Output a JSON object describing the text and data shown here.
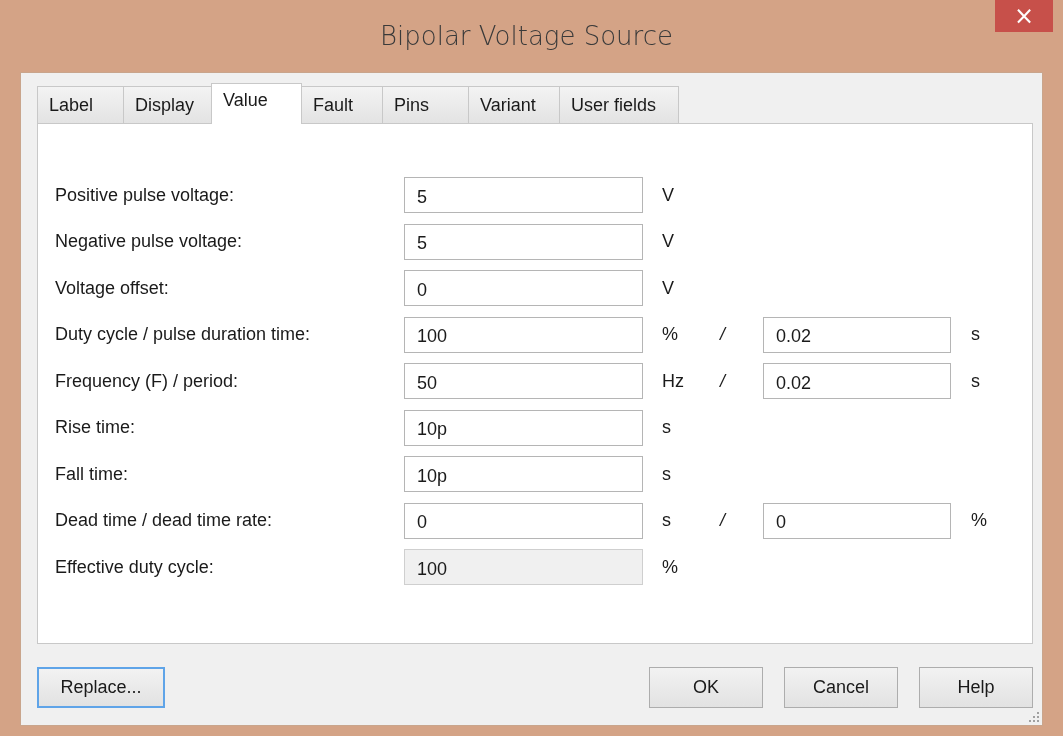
{
  "window": {
    "title": "Bipolar Voltage Source",
    "close": "×"
  },
  "tabs": [
    {
      "label": "Label",
      "selected": false
    },
    {
      "label": "Display",
      "selected": false
    },
    {
      "label": "Value",
      "selected": true
    },
    {
      "label": "Fault",
      "selected": false
    },
    {
      "label": "Pins",
      "selected": false
    },
    {
      "label": "Variant",
      "selected": false
    },
    {
      "label": "User fields",
      "selected": false
    }
  ],
  "rows": [
    {
      "label": "Positive pulse voltage:",
      "value": "5",
      "unit": "V",
      "disabled": false
    },
    {
      "label": "Negative pulse voltage:",
      "value": "5",
      "unit": "V",
      "disabled": false
    },
    {
      "label": "Voltage offset:",
      "value": "0",
      "unit": "V",
      "disabled": false
    },
    {
      "label": "Duty cycle / pulse duration time:",
      "value": "100",
      "unit": "%",
      "disabled": false,
      "separator": "/",
      "value_2": "0.02",
      "unit_2": "s"
    },
    {
      "label": "Frequency (F) / period:",
      "value": "50",
      "unit": "Hz",
      "disabled": false,
      "separator": "/",
      "value_2": "0.02",
      "unit_2": "s"
    },
    {
      "label": "Rise time:",
      "value": "10p",
      "unit": "s",
      "disabled": false
    },
    {
      "label": "Fall time:",
      "value": "10p",
      "unit": "s",
      "disabled": false
    },
    {
      "label": "Dead time / dead time rate:",
      "value": "0",
      "unit": "s",
      "disabled": false,
      "separator": "/",
      "value_2": "0",
      "unit_2": "%"
    },
    {
      "label": "Effective duty cycle:",
      "value": "100",
      "unit": "%",
      "disabled": true
    }
  ],
  "buttons_left": [
    {
      "label": "Replace...",
      "focused": true
    }
  ],
  "buttons_right": [
    {
      "label": "OK",
      "focused": false
    },
    {
      "label": "Cancel",
      "focused": false
    },
    {
      "label": "Help",
      "focused": false
    }
  ]
}
